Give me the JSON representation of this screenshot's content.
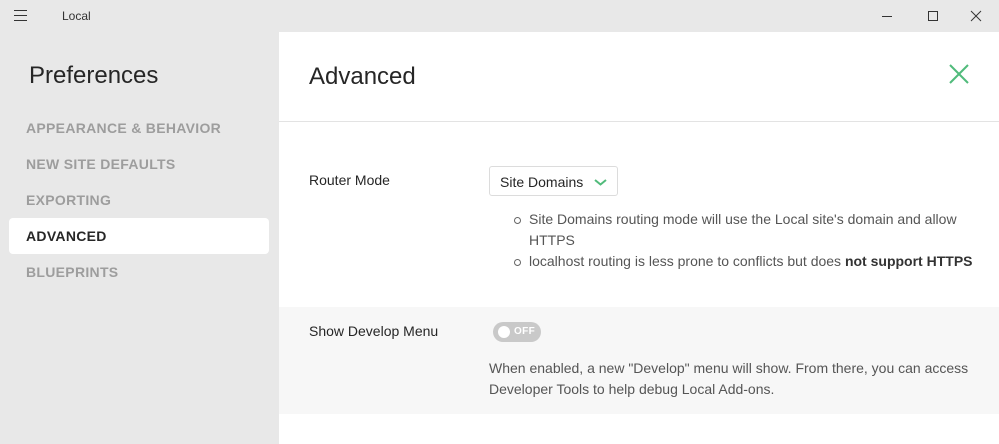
{
  "window": {
    "title": "Local",
    "menu_icon": "hamburger-menu-icon",
    "controls": [
      "minimize-icon",
      "maximize-icon",
      "close-icon"
    ]
  },
  "sidebar": {
    "title": "Preferences",
    "items": [
      {
        "label": "APPEARANCE & BEHAVIOR",
        "active": false
      },
      {
        "label": "NEW SITE DEFAULTS",
        "active": false
      },
      {
        "label": "EXPORTING",
        "active": false
      },
      {
        "label": "ADVANCED",
        "active": true
      },
      {
        "label": "BLUEPRINTS",
        "active": false
      }
    ]
  },
  "main": {
    "title": "Advanced",
    "close_icon": "close-x-icon",
    "router_mode": {
      "label": "Router Mode",
      "selected": "Site Domains",
      "bullet1": "Site Domains routing mode will use the Local site's domain and allow HTTPS",
      "bullet2_text": "localhost routing is less prone to conflicts but does ",
      "bullet2_bold": "not support HTTPS"
    },
    "develop_menu": {
      "label": "Show Develop Menu",
      "toggle_state": "OFF",
      "description": "When enabled, a new \"Develop\" menu will show. From there, you can access Developer Tools to help debug Local Add-ons."
    }
  },
  "colors": {
    "accent": "#51bb7b",
    "sidebar_bg": "#e8e8e8",
    "inactive_nav": "#9d9d9d",
    "toggle_off": "#c9c9c9"
  }
}
